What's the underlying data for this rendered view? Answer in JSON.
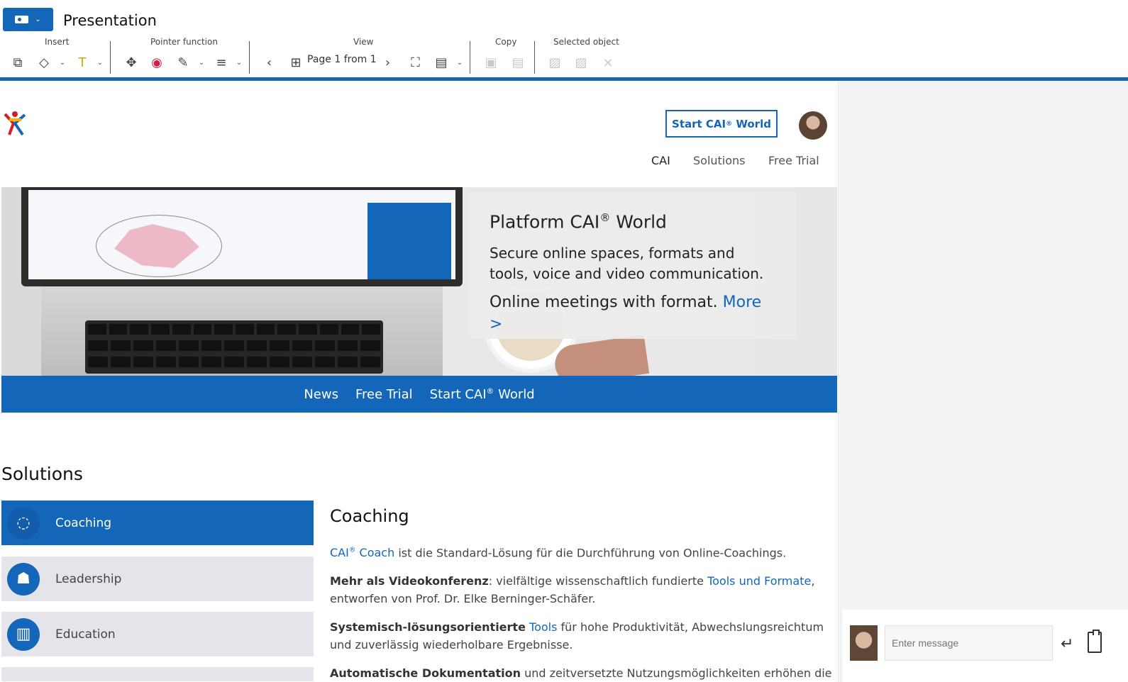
{
  "header": {
    "title": "Presentation",
    "groups": {
      "insert": "Insert",
      "pointer": "Pointer function",
      "view": "View",
      "copy": "Copy",
      "selected": "Selected object"
    },
    "page_indicator": "Page 1 from 1"
  },
  "site": {
    "start_button": "Start CAI",
    "start_button_suffix": "World",
    "nav": [
      "CAI",
      "Solutions",
      "Free Trial"
    ],
    "hero_title": "Platform CAI",
    "hero_title_suffix": "World",
    "hero_text": "Secure online spaces, formats and tools, voice and video communication.",
    "hero_text2": "Online meetings with format.",
    "hero_more": "More >",
    "blue_nav": [
      "News",
      "Free Trial",
      "Start CAI",
      "World"
    ]
  },
  "solutions": {
    "title": "Solutions",
    "items": [
      "Coaching",
      "Leadership",
      "Education"
    ]
  },
  "content": {
    "heading": "Coaching",
    "p1_link": "CAI",
    "p1_link_suffix": "Coach",
    "p1_text": "ist die Standard-Lösung für die Durchführung von Online-Coachings.",
    "p2_strong": "Mehr als Videokonferenz",
    "p2_text": ": vielfältige wissenschaftlich fundierte",
    "p2_link": "Tools und Formate",
    "p2_tail": ", entworfen von Prof. Dr. Elke Berninger-Schäfer.",
    "p3_strong": "Systemisch-lösungsorientierte",
    "p3_link": "Tools",
    "p3_text": "für hohe Produktivität, Abwechslungsreichtum und zuverlässig wiederholbare Ergebnisse.",
    "p4_strong": "Automatische Dokumentation",
    "p4_text": "und zeitversetzte Nutzungsmöglichkeiten erhöhen die"
  },
  "chat": {
    "placeholder": "Enter message"
  },
  "colors": {
    "accent": "#1466b8"
  }
}
